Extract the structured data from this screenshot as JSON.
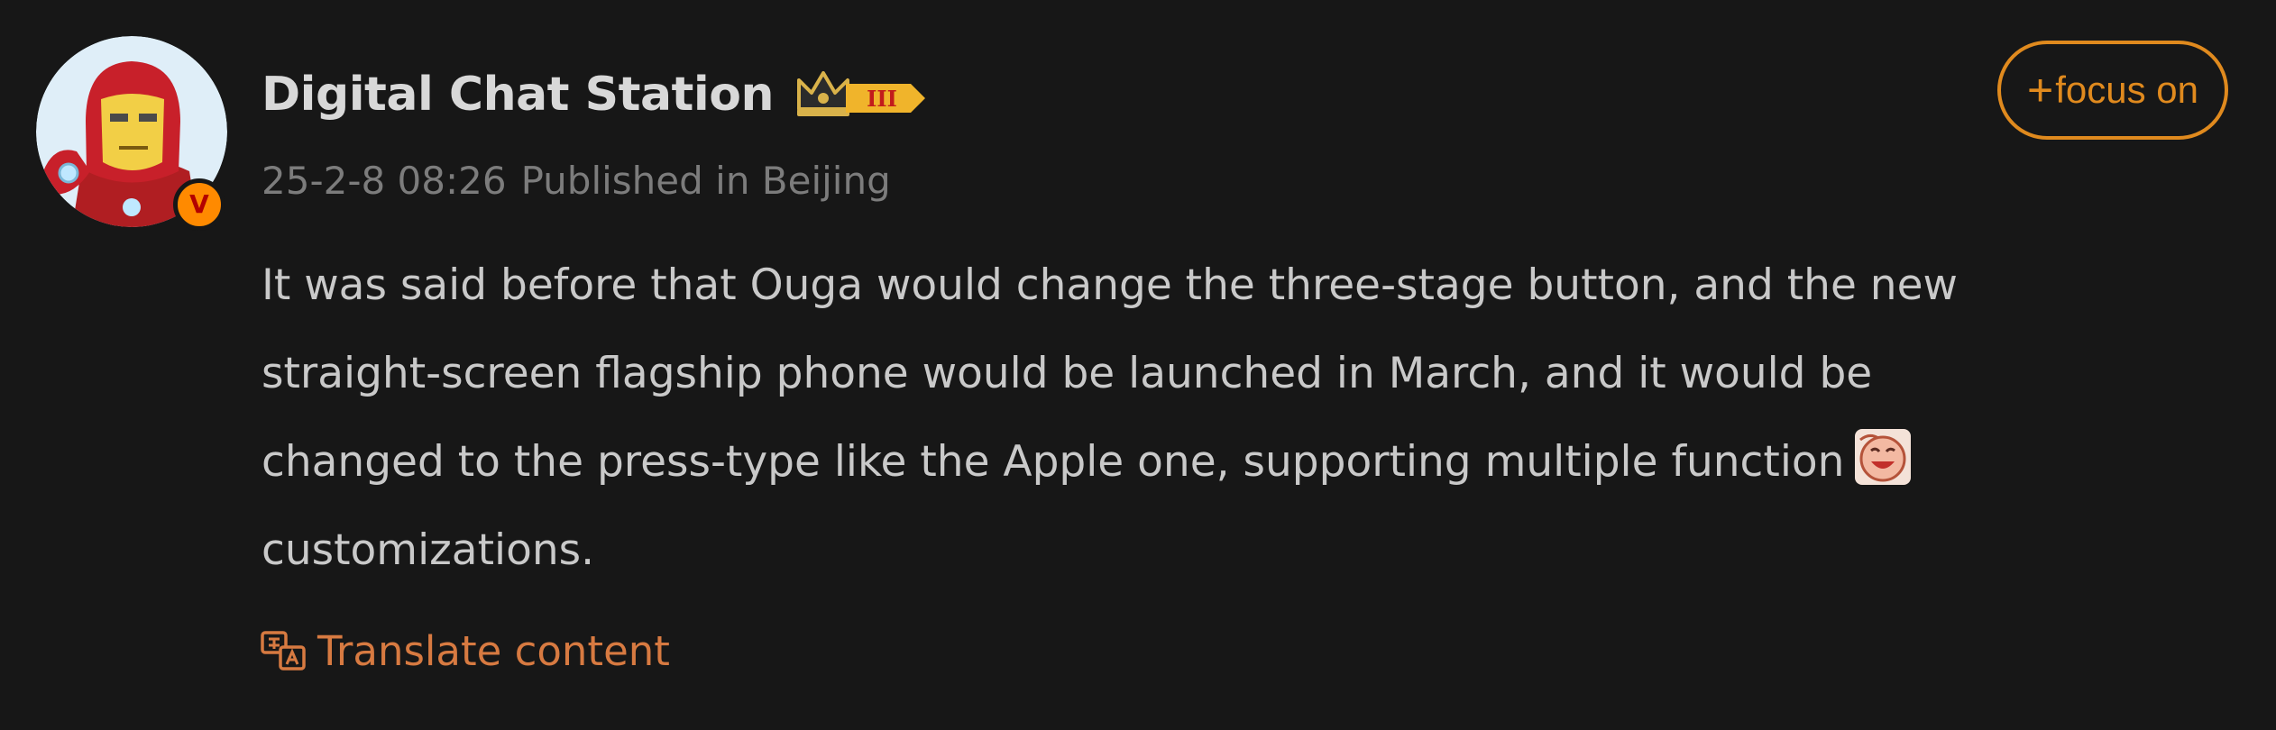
{
  "post": {
    "author": {
      "name": "Digital Chat Station",
      "verified_mark": "V",
      "rank_badge_text": "III"
    },
    "meta": {
      "timestamp": "25-2-8 08:26",
      "location": "Published in Beijing"
    },
    "follow_button": {
      "plus": "+",
      "label": "focus on"
    },
    "body_lines": [
      "It was said before that Ouga would change the three-stage button, and the new",
      "straight-screen flagship phone would be launched in March, and it would be",
      "changed to the press-type like the Apple one, supporting multiple function",
      "customizations."
    ],
    "emoji_icon": "laughing-face-emoji",
    "translate_label": "Translate content"
  },
  "colors": {
    "background": "#171717",
    "accent": "#e08a1e",
    "translate": "#d77a41",
    "text": "#c9c9c9",
    "meta": "#7c7c7c"
  }
}
